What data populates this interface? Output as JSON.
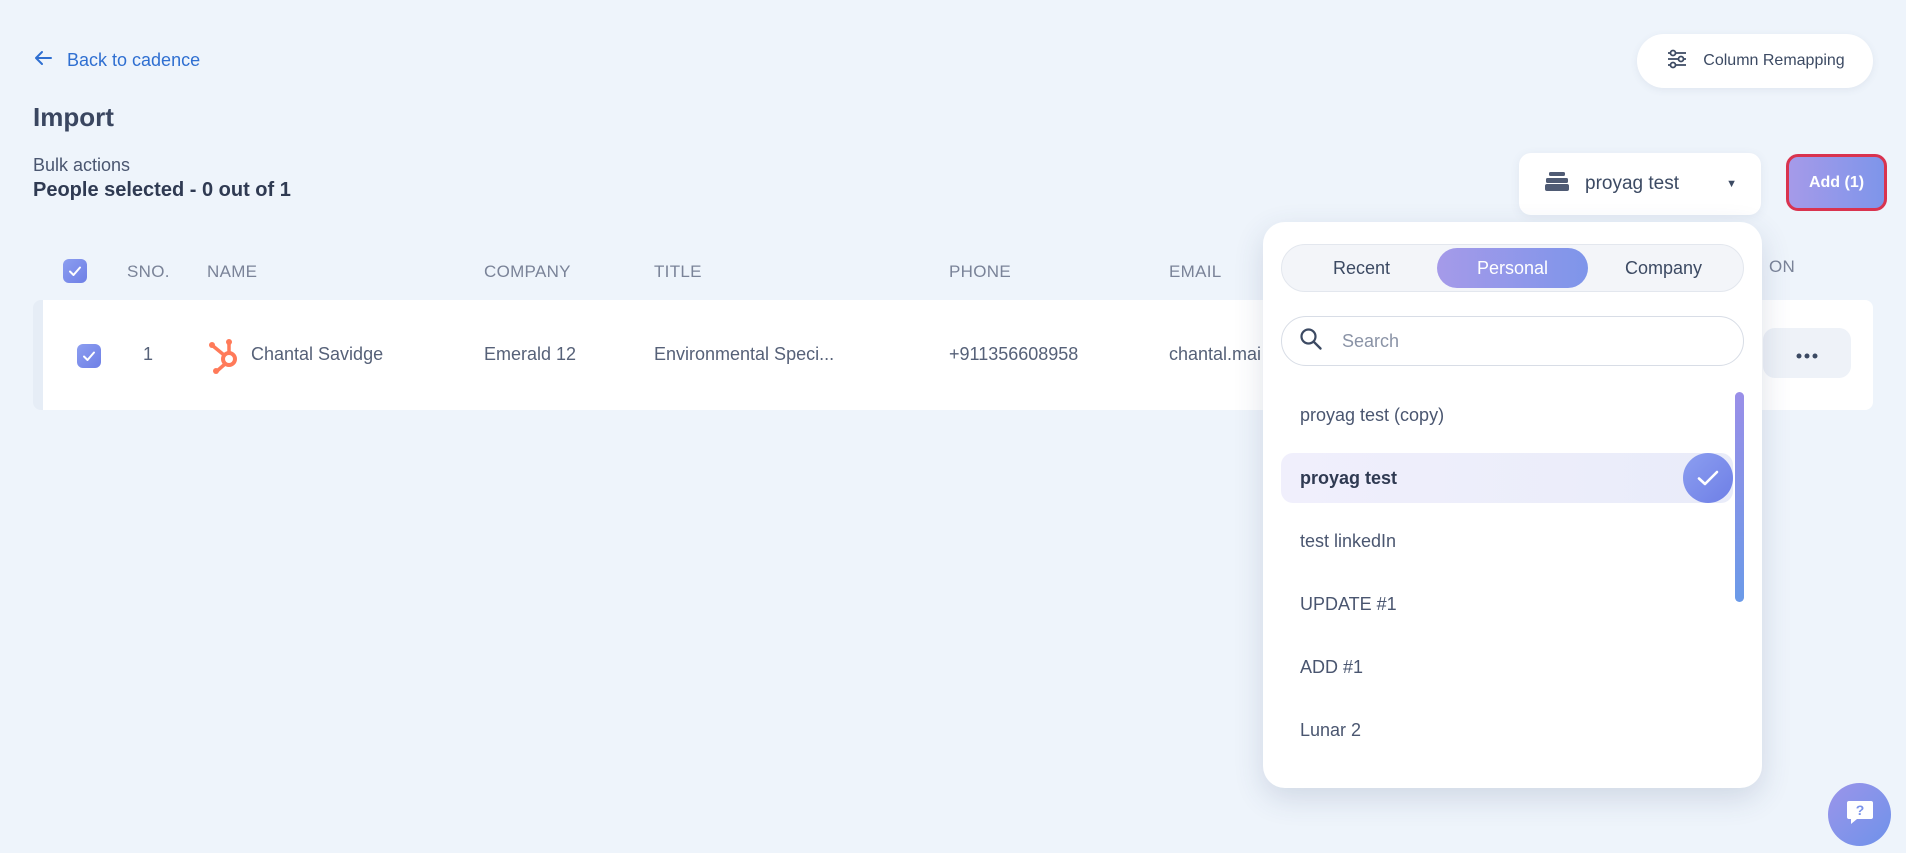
{
  "header": {
    "back_label": "Back to cadence",
    "column_remap_label": "Column Remapping",
    "title": "Import",
    "bulk_label": "Bulk actions",
    "people_selected": "People selected - 0 out of 1"
  },
  "list_select": {
    "value": "proyag test"
  },
  "add_button": {
    "label": "Add (1)"
  },
  "table": {
    "columns": [
      "SNO.",
      "NAME",
      "COMPANY",
      "TITLE",
      "PHONE",
      "EMAIL",
      "ON"
    ],
    "rows": [
      {
        "sno": "1",
        "name": "Chantal Savidge",
        "company": "Emerald 12",
        "title": "Environmental Speci...",
        "phone": "+911356608958",
        "email": "chantal.mai"
      }
    ]
  },
  "dropdown": {
    "tabs": [
      "Recent",
      "Personal",
      "Company"
    ],
    "active_tab": "Personal",
    "search_placeholder": "Search",
    "options": [
      "proyag test (copy)",
      "proyag test",
      "test linkedIn",
      "UPDATE #1",
      "ADD #1",
      "Lunar 2"
    ],
    "selected": "proyag test"
  },
  "colors": {
    "accent": "#7e95ea",
    "link": "#2f6fd1",
    "hubspot": "#ff7a59",
    "error_border": "#d9334f"
  },
  "icons": {
    "back": "arrow-left-icon",
    "column_remap": "sliders-icon",
    "list": "stack-icon",
    "hubspot": "hubspot-icon",
    "search": "search-icon",
    "help": "help-chat-icon"
  }
}
